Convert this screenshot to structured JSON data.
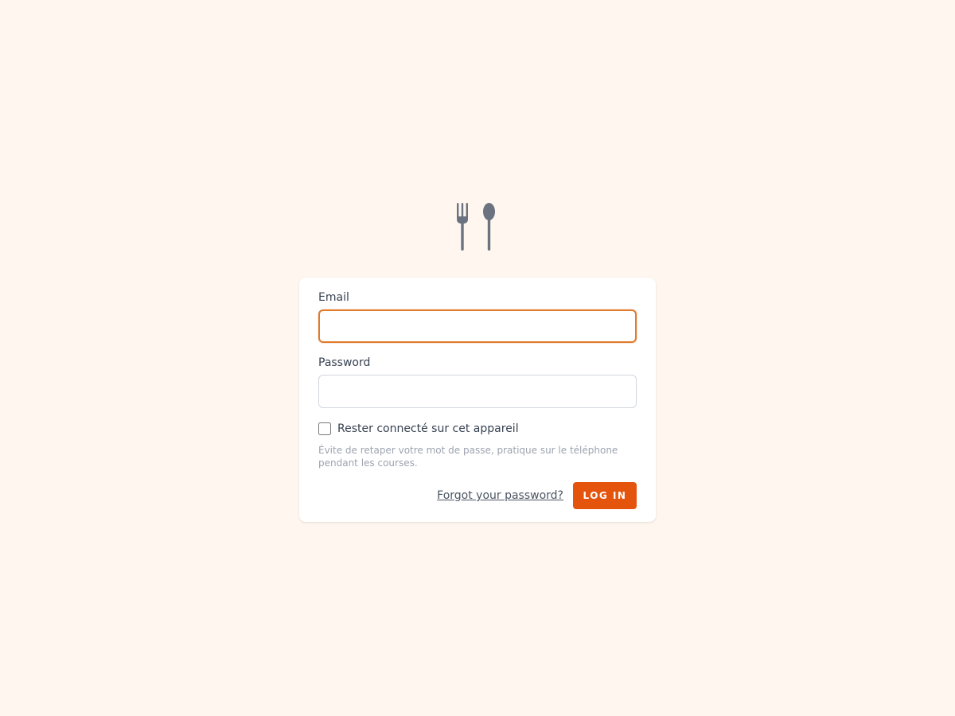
{
  "logo": {
    "icon": "fork-and-spoon-icon",
    "color": "#6b7280"
  },
  "form": {
    "email_label": "Email",
    "email_value": "",
    "password_label": "Password",
    "password_value": "",
    "remember_label": "Rester connecté sur cet appareil",
    "remember_checked": false,
    "hint": "Évite de retaper votre mot de passe, pratique sur le téléphone pendant les courses.",
    "forgot_label": "Forgot your password?",
    "login_label": "LOG IN"
  },
  "colors": {
    "background": "#fff7ef",
    "accent": "#e5540c",
    "focus_ring": "#e07a2c"
  }
}
